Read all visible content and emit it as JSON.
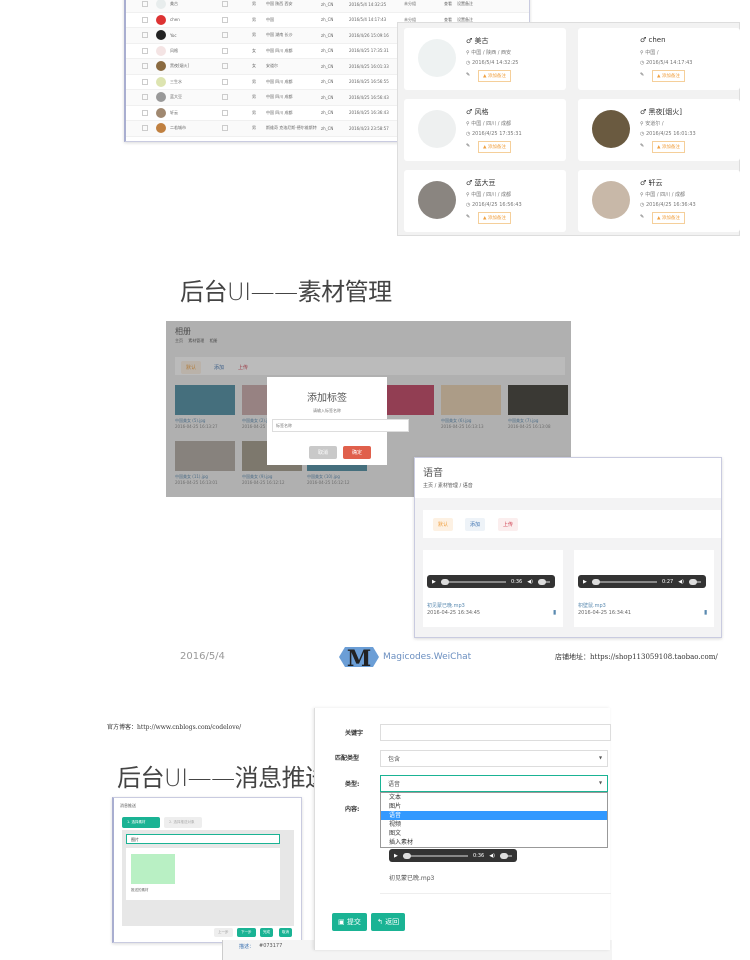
{
  "user_table": {
    "rows": [
      {
        "name": "美古",
        "sex": "男",
        "region": "中国 陕西 西安",
        "lang": "zh_CN",
        "time": "2016/5/4 14:32:25",
        "group": "未分组",
        "actions": [
          "查看",
          "设置备注"
        ]
      },
      {
        "name": "chen",
        "sex": "男",
        "region": "中国",
        "lang": "zh_CN",
        "time": "2016/5/4 14:17:43",
        "group": "未分组",
        "actions": [
          "查看",
          "设置备注"
        ]
      },
      {
        "name": "Yoc",
        "sex": "男",
        "region": "中国 湖南 长沙",
        "lang": "zh_CN",
        "time": "2016/4/26 15:09:16",
        "group": "未分组",
        "actions": [
          "查看",
          "设置备注"
        ]
      },
      {
        "name": "风格",
        "sex": "女",
        "region": "中国 四川 成都",
        "lang": "zh_CN",
        "time": "2016/4/25 17:35:31",
        "group": "未分组",
        "actions": [
          "查看",
          "设置备注"
        ]
      },
      {
        "name": "黑夜[烟火]",
        "sex": "女",
        "region": "安道尔",
        "lang": "zh_CN",
        "time": "2016/4/25 16:01:33",
        "group": "未分组",
        "actions": [
          "查看",
          "设置备注"
        ]
      },
      {
        "name": "三生水",
        "sex": "男",
        "region": "中国 四川 成都",
        "lang": "zh_CN",
        "time": "2016/4/25 16:56:55",
        "group": "未分组",
        "actions": [
          "查看",
          "设置备注"
        ]
      },
      {
        "name": "蓝大豆",
        "sex": "男",
        "region": "中国 四川 成都",
        "lang": "zh_CN",
        "time": "2016/4/25 16:56:43",
        "group": "未分组",
        "actions": [
          "查看",
          "设置备注"
        ]
      },
      {
        "name": "轩云",
        "sex": "男",
        "region": "中国 四川 成都",
        "lang": "zh_CN",
        "time": "2016/4/25 16:36:43",
        "group": "未分组",
        "actions": [
          "查看",
          "设置备注"
        ]
      },
      {
        "name": "二若城市",
        "sex": "男",
        "region": "斯维奇 克洛尼斯-德尔维斯特",
        "lang": "zh_CN",
        "time": "2016/4/23 23:58:57",
        "group": "未分组",
        "actions": [
          "查看",
          "设置备注"
        ]
      }
    ]
  },
  "user_cards": [
    {
      "name": "美古",
      "location": "中国 / 陕西 / 西安",
      "time": "2016/5/4 14:32:25",
      "tag": "添加备注"
    },
    {
      "name": "chen",
      "location": "中国 /",
      "time": "2016/5/4 14:17:43",
      "tag": "添加备注"
    },
    {
      "name": "风格",
      "location": "中国 / 四川 / 成都",
      "time": "2016/4/25 17:35:31",
      "tag": "添加备注"
    },
    {
      "name": "黑夜[烟火]",
      "location": "安道尔 /",
      "time": "2016/4/25 16:01:33",
      "tag": "添加备注"
    },
    {
      "name": "蓝大豆",
      "location": "中国 / 四川 / 成都",
      "time": "2016/4/25 16:56:43",
      "tag": "添加备注"
    },
    {
      "name": "轩云",
      "location": "中国 / 四川 / 成都",
      "time": "2016/4/25 16:36:43",
      "tag": "添加备注"
    }
  ],
  "section1_title": "后台UI——素材管理",
  "gallery": {
    "title": "相册",
    "breadcrumb": [
      "主页",
      "素材管理",
      "相册"
    ],
    "buttons": [
      "默认",
      "添加",
      "上传"
    ],
    "images": [
      {
        "name": "中国美女 (5).jpg",
        "time": "2016-04-25 16:13:27"
      },
      {
        "name": "中国美女 (2).jpg",
        "time": "2016-04-25 16:13:17"
      },
      {
        "name": "中国美女 (6).jpg",
        "time": "2016-04-25 16:13:13"
      },
      {
        "name": "中国美女 (7).jpg",
        "time": "2016-04-25 16:13:08"
      },
      {
        "name": "中国美女 (11).jpg",
        "time": "2016-04-25 16:13:01"
      },
      {
        "name": "中国美女 (9).jpg",
        "time": "2016-04-25 16:12:12"
      },
      {
        "name": "中国美女 (10).jpg",
        "time": "2016-04-25 16:12:12"
      }
    ]
  },
  "modal": {
    "title": "添加标签",
    "prompt": "请输入标签名称",
    "placeholder": "标签名称",
    "cancel": "取消",
    "confirm": "确定"
  },
  "voice": {
    "title": "语音",
    "breadcrumb": [
      "主页",
      "素材管理",
      "语音"
    ],
    "buttons": [
      "默认",
      "添加",
      "上传"
    ],
    "items": [
      {
        "file": "初见蒙已晚.mp3",
        "time": "2016-04-25 16:34:45",
        "duration": "0:36"
      },
      {
        "file": "枳壁鼠.mp3",
        "time": "2016-04-25 16:34:41",
        "duration": "0:27"
      }
    ]
  },
  "footer": {
    "date": "2016/5/4",
    "brand": "Magicodes.WeiChat",
    "shop": "店铺地址：https://shop113059108.taobao.com/"
  },
  "blog": "官方博客：http://www.cnblogs.com/codelove/",
  "section2_title": "后台UI——消息推送",
  "wizard": {
    "title": "消息推送",
    "steps": [
      "1. 选择素材",
      "2. 选择推送对象"
    ],
    "select": "图片",
    "item_caption": "推送的素材",
    "buttons": [
      "上一步",
      "下一步",
      "完成",
      "取消"
    ]
  },
  "reply_form": {
    "keyword_label": "关键字",
    "keyword_value": "",
    "match_label": "匹配类型",
    "match_value": "包含",
    "type_label": "类型:",
    "type_value": "语音",
    "type_options": [
      "文本",
      "图片",
      "语音",
      "视频",
      "图文",
      "插入素材"
    ],
    "type_selected": "语音",
    "content_label": "内容:",
    "audio_duration": "0:36",
    "audio_file": "初见蒙已晚.mp3",
    "submit": "提交",
    "back": "返回"
  },
  "bottom_strip": {
    "label": "描述：",
    "value": "#073177"
  },
  "colors": {
    "accent_green": "#1ab394",
    "tag_orange": "#f0a040",
    "danger": "#e0604c",
    "selected": "#3399ff"
  }
}
